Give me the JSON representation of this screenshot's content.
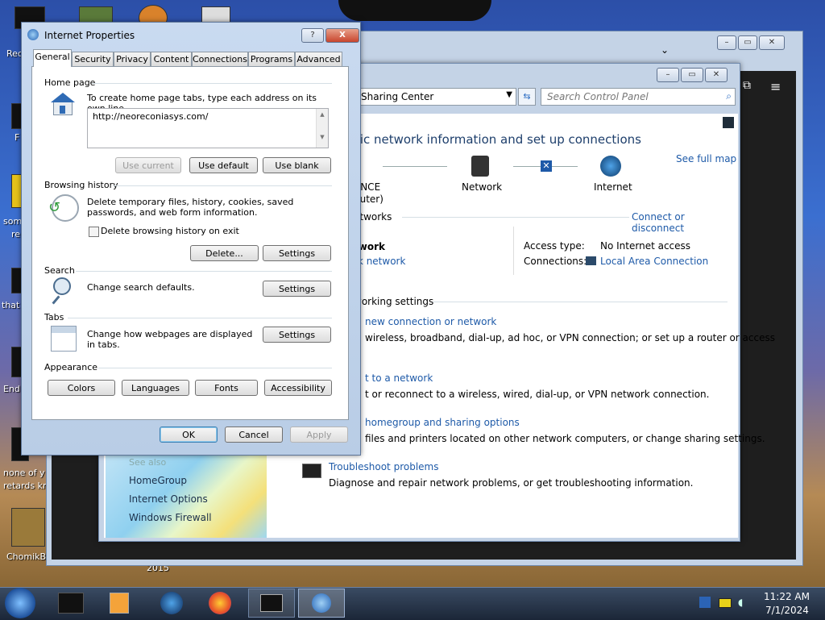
{
  "desktop": {
    "labels": [
      "Rec",
      "F",
      "som",
      "re",
      "that",
      "End",
      "none of y",
      "retards kn",
      "ChomikB",
      "2015"
    ]
  },
  "control_panel": {
    "address": "Sharing Center",
    "search_placeholder": "Search Control Panel",
    "heading": "sic network information and set up connections",
    "see_full_map": "See full map",
    "map_left_1": "ANCE",
    "map_left_2": "puter)",
    "map_network": "Network",
    "map_internet": "Internet",
    "active_networks": "etworks",
    "connect_disconnect": "Connect or disconnect",
    "network_name": "twork",
    "network_type": "rk network",
    "access_type_label": "Access type:",
    "access_type_value": "No Internet access",
    "connections_label": "Connections:",
    "connections_value": "Local Area Connection",
    "change_settings": "working settings",
    "t1_link": "new connection or network",
    "t1_desc": "wireless, broadband, dial-up, ad hoc, or VPN connection; or set up a router or access",
    "t2_link": "t to a network",
    "t2_desc": "t or reconnect to a wireless, wired, dial-up, or VPN network connection.",
    "t3_link": "homegroup and sharing options",
    "t3_desc": "files and printers located on other network computers, or change sharing settings.",
    "t4_link": "Troubleshoot problems",
    "t4_desc": "Diagnose and repair network problems, or get troubleshooting information.",
    "see_also": "See also",
    "see_also_items": [
      "HomeGroup",
      "Internet Options",
      "Windows Firewall"
    ]
  },
  "dialog": {
    "title": "Internet Properties",
    "help": "?",
    "close": "X",
    "tabs": [
      "General",
      "Security",
      "Privacy",
      "Content",
      "Connections",
      "Programs",
      "Advanced"
    ],
    "home_page": {
      "heading": "Home page",
      "desc": "To create home page tabs, type each address on its own line.",
      "url": "http://neoreconiasys.com/",
      "use_current": "Use current",
      "use_default": "Use default",
      "use_blank": "Use blank"
    },
    "browsing_history": {
      "heading": "Browsing history",
      "desc": "Delete temporary files, history, cookies, saved passwords, and web form information.",
      "checkbox": "Delete browsing history on exit",
      "delete": "Delete...",
      "settings": "Settings"
    },
    "search": {
      "heading": "Search",
      "desc": "Change search defaults.",
      "settings": "Settings"
    },
    "tabs_section": {
      "heading": "Tabs",
      "desc": "Change how webpages are displayed in tabs.",
      "settings": "Settings"
    },
    "appearance": {
      "heading": "Appearance",
      "colors": "Colors",
      "languages": "Languages",
      "fonts": "Fonts",
      "accessibility": "Accessibility"
    },
    "ok": "OK",
    "cancel": "Cancel",
    "apply": "Apply"
  },
  "taskbar": {
    "time": "11:22 AM",
    "date": "7/1/2024"
  },
  "colors": {
    "link": "#1e5aa8",
    "taskbar": "#1d2a3a"
  }
}
